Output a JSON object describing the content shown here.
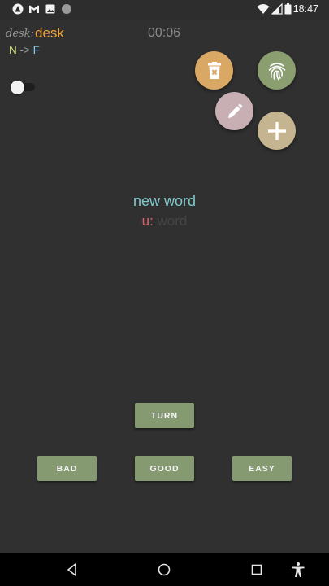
{
  "status_bar": {
    "time": "18:47",
    "left_icons": [
      "app-icon",
      "gmail-icon",
      "image-icon",
      "circle-icon"
    ],
    "right_icons": [
      "wifi-icon",
      "signal-icon",
      "battery-icon"
    ]
  },
  "header": {
    "desk_prefix": "desk:",
    "desk_name": "desk",
    "timer": "00:06",
    "direction_from": "N",
    "direction_arrow": "->",
    "direction_to": "F"
  },
  "toggle": {
    "state": "off"
  },
  "actions": {
    "delete": {
      "icon": "delete-icon",
      "color": "#d9a865"
    },
    "fingerprint": {
      "icon": "fingerprint-icon",
      "color": "#8a9e6f"
    },
    "edit": {
      "icon": "pencil-icon",
      "color": "#c7afb4"
    },
    "add": {
      "icon": "plus-icon",
      "color": "#c4b48f"
    }
  },
  "card": {
    "word": "new word",
    "word_color": "#7ec8cc",
    "translation_label": "u:",
    "translation_text": "word"
  },
  "buttons": {
    "turn": "TURN",
    "bad": "BAD",
    "good": "GOOD",
    "easy": "EASY",
    "color": "#869a72"
  },
  "nav_bar": {
    "icons": [
      "back-icon",
      "home-icon",
      "recents-icon",
      "accessibility-icon"
    ]
  }
}
